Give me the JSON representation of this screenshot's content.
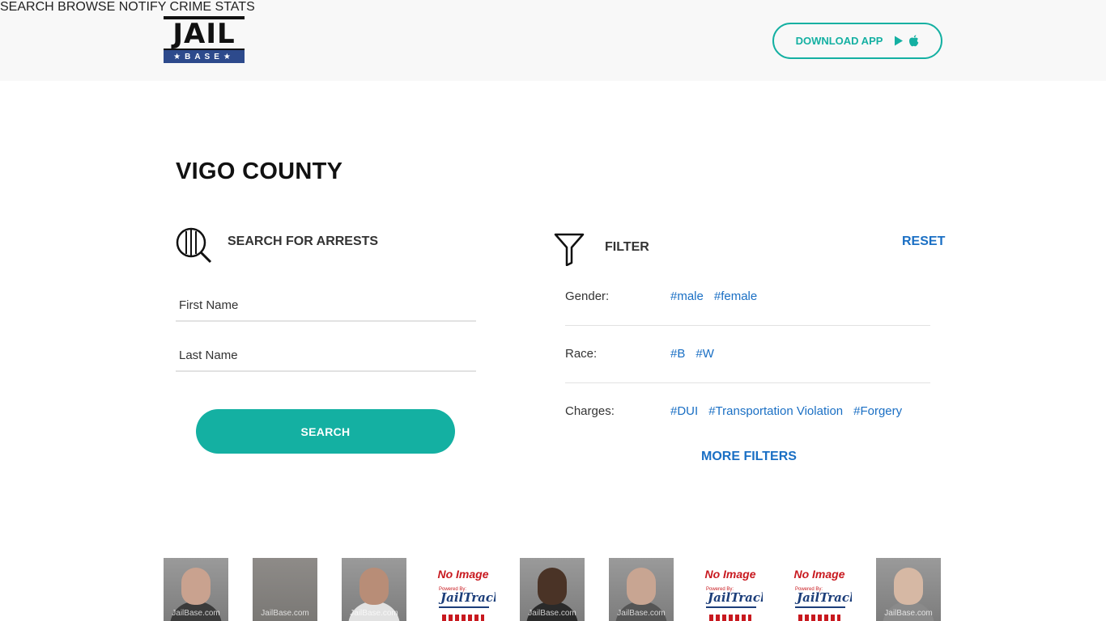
{
  "header": {
    "logo_top": "JAIL",
    "logo_bottom": "★BASE★",
    "nav": [
      {
        "label": "SEARCH"
      },
      {
        "label": "BROWSE"
      },
      {
        "label": "NOTIFY"
      },
      {
        "label": "CRIME STATS"
      }
    ],
    "download_label": "DOWNLOAD APP",
    "download_icons": [
      "google-play-icon",
      "apple-icon"
    ]
  },
  "page": {
    "title": "VIGO COUNTY"
  },
  "search": {
    "heading": "SEARCH FOR ARRESTS",
    "icon": "magnifier-icon",
    "first_name_placeholder": "First Name",
    "last_name_placeholder": "Last Name",
    "button_label": "SEARCH"
  },
  "filter": {
    "heading": "FILTER",
    "icon": "funnel-icon",
    "reset_label": "RESET",
    "rows": [
      {
        "label": "Gender:",
        "tags": [
          "#male",
          "#female"
        ]
      },
      {
        "label": "Race:",
        "tags": [
          "#B",
          "#W"
        ]
      },
      {
        "label": "Charges:",
        "tags": [
          "#DUI",
          "#Transportation Violation",
          "#Forgery"
        ]
      }
    ],
    "more_label": "MORE FILTERS"
  },
  "mugshots": {
    "watermark": "JailBase.com",
    "no_image_title": "No Image",
    "no_image_brand": "JailTracker",
    "no_image_powered": "Powered By:"
  },
  "colors": {
    "accent": "#14b0a2",
    "link": "#1a6fc4",
    "header_bg": "#f8f8f8",
    "logo_blue": "#2d4a8c"
  }
}
